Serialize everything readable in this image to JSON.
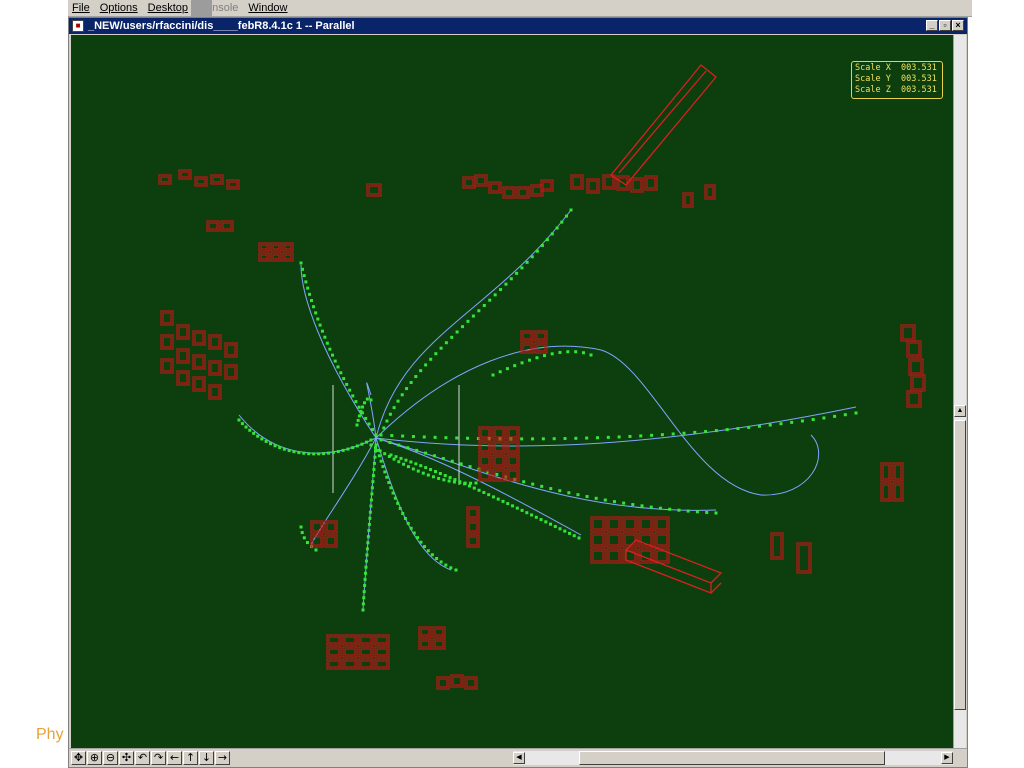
{
  "menubar": {
    "items": [
      {
        "label": "File"
      },
      {
        "label": "Options"
      },
      {
        "label": "Desktop"
      },
      {
        "label": "Console"
      },
      {
        "label": "Window"
      }
    ]
  },
  "window": {
    "title": "_NEW/users/rfaccini/dis____febR8.4.1c 1 -- Parallel",
    "buttons": {
      "minimize": "_",
      "maximize": "▫",
      "close": "×"
    }
  },
  "scale_panel": {
    "x": "Scale X  003.531",
    "y": "Scale Y  003.531",
    "z": "Scale Z  003.531"
  },
  "toolbar": {
    "tools": [
      {
        "name": "move-tool",
        "glyph": "✥"
      },
      {
        "name": "zoom-in-tool",
        "glyph": "⊕"
      },
      {
        "name": "zoom-out-tool",
        "glyph": "⊖"
      },
      {
        "name": "pan-tool",
        "glyph": "✣"
      },
      {
        "name": "rotate-left-tool",
        "glyph": "↶"
      },
      {
        "name": "rotate-right-tool",
        "glyph": "↷"
      },
      {
        "name": "left-arrow-tool",
        "glyph": "←"
      },
      {
        "name": "up-arrow-tool",
        "glyph": "↑"
      },
      {
        "name": "down-arrow-tool",
        "glyph": "↓"
      },
      {
        "name": "right-arrow-tool",
        "glyph": "→"
      }
    ]
  },
  "slide_footer": {
    "text": "Phy"
  },
  "colors": {
    "canvas_bg": "#0d3e0e",
    "hit_green": "#34e43a",
    "track_blue": "#7fa6ff",
    "detector_red": "#c01818",
    "scale_text": "#f0e060"
  }
}
